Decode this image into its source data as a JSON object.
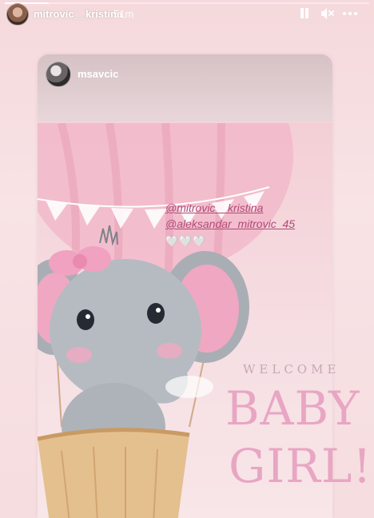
{
  "story": {
    "username": "mitrovic__kristina",
    "time_ago": "51m",
    "progress": 0.12,
    "icons": {
      "pause": "pause-icon",
      "mute": "mute-icon",
      "more": "more-icon"
    }
  },
  "shared_post": {
    "username": "msavcic",
    "mentions": [
      "@mitrovic__kristina",
      "@aleksandar_mitrovic_45"
    ],
    "hearts": "🤍🤍🤍",
    "image_text": {
      "welcome": "WELCOME",
      "line1": "BABY",
      "line2": "GIRL!"
    }
  },
  "colors": {
    "accent_pink": "#e8a6c3",
    "mention": "#b04a78",
    "background": "#f6dde0"
  }
}
